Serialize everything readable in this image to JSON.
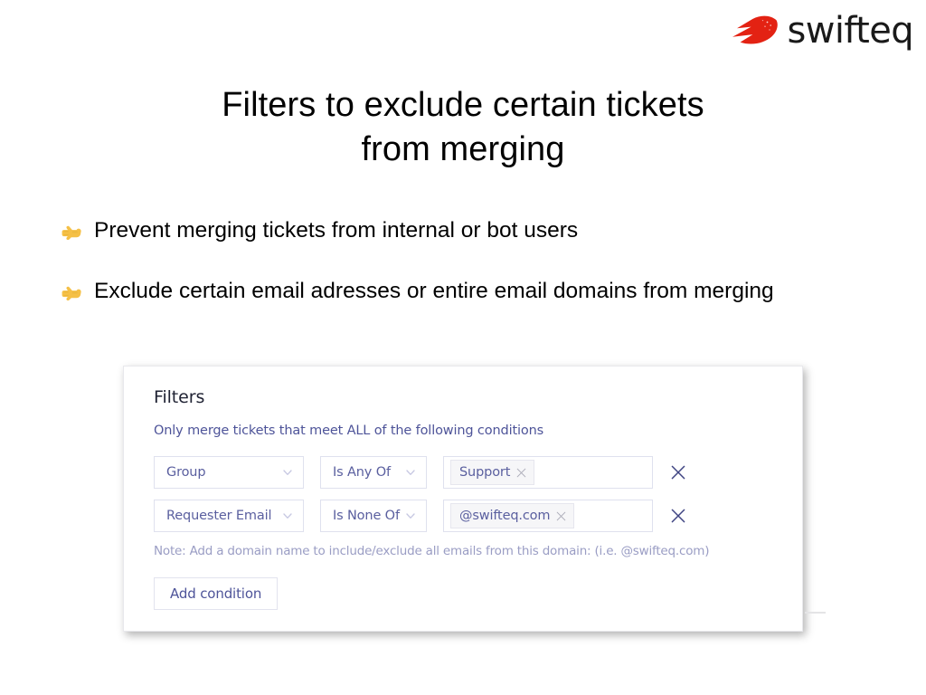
{
  "brand": {
    "name": "swifteq",
    "mark_icon": "swifteq-comet-icon",
    "mark_color": "#e32213",
    "name_color": "#1a1a1a"
  },
  "slide": {
    "title_line_1": "Filters to exclude certain tickets",
    "title_line_2": "from merging",
    "bullets": [
      {
        "icon": "pointing-right-hand-icon",
        "text": "Prevent merging tickets from internal or bot users"
      },
      {
        "icon": "pointing-right-hand-icon",
        "text": "Exclude certain email adresses or entire email domains from merging"
      }
    ]
  },
  "filters_card": {
    "title": "Filters",
    "subtitle": "Only merge tickets that meet ALL of the following conditions",
    "conditions": [
      {
        "attribute": "Group",
        "operator": "Is Any Of",
        "values": [
          "Support"
        ],
        "attribute_chevron_icon": "chevron-down-icon",
        "operator_chevron_icon": "chevron-down-icon",
        "tag_remove_icon": "close-icon",
        "row_remove_icon": "close-icon"
      },
      {
        "attribute": "Requester Email",
        "operator": "Is None Of",
        "values": [
          "@swifteq.com"
        ],
        "attribute_chevron_icon": "chevron-down-icon",
        "operator_chevron_icon": "chevron-down-icon",
        "tag_remove_icon": "close-icon",
        "row_remove_icon": "close-icon"
      }
    ],
    "note": "Note: Add a domain name to include/exclude all emails from this domain: (i.e. @swifteq.com)",
    "add_condition_label": "Add condition",
    "colors": {
      "accent_text": "#5a5f9f",
      "subtitle": "#4e5499",
      "note": "#9a9dc4",
      "border": "#dfe1ee",
      "chip_background": "#f6f6f8"
    }
  }
}
